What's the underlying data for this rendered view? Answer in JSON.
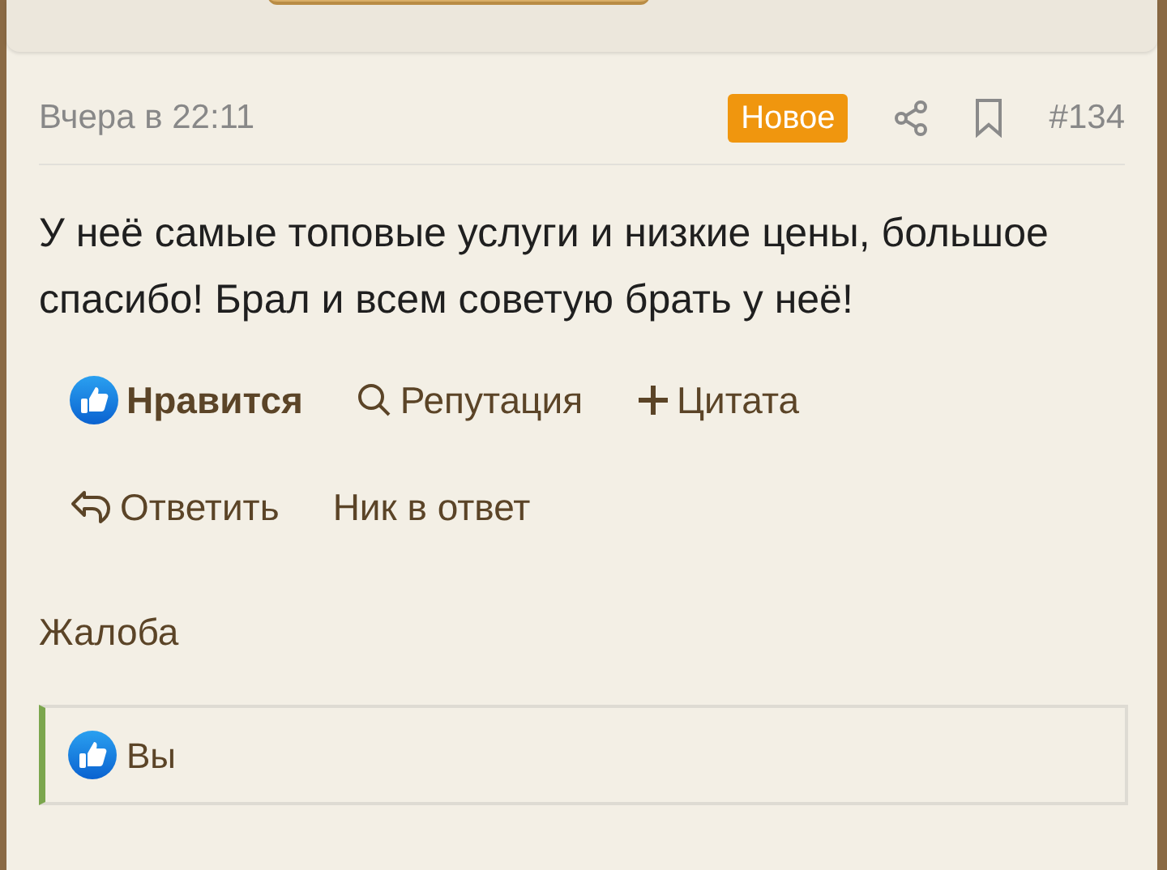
{
  "post": {
    "date": "Вчера в 22:11",
    "badge": "Новое",
    "number": "#134",
    "text": "У неё самые топовые услуги и низкие цены, большое спасибо! Брал и всем советую брать у неё!",
    "actions": [
      {
        "kind": "like",
        "label": "Нравится"
      },
      {
        "kind": "reputation",
        "label": "Репутация"
      },
      {
        "kind": "quote",
        "label": "Цитата"
      },
      {
        "kind": "reply",
        "label": "Ответить"
      },
      {
        "kind": "plain",
        "label": "Ник в ответ"
      }
    ],
    "report": "Жалоба",
    "reactions": {
      "label": "Вы"
    }
  }
}
